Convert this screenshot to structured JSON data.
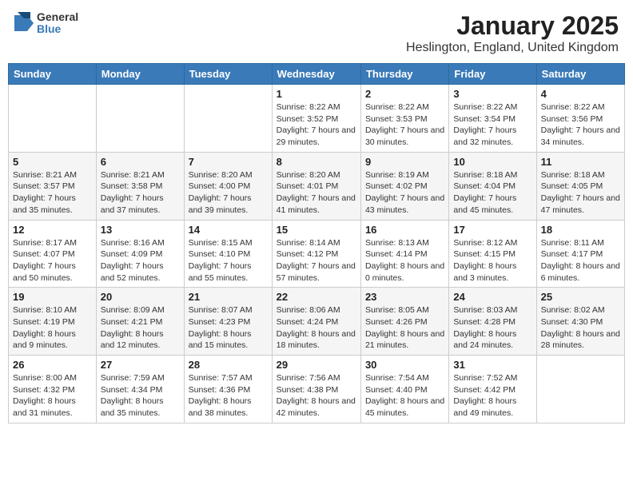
{
  "header": {
    "logo_general": "General",
    "logo_blue": "Blue",
    "month_title": "January 2025",
    "location": "Heslington, England, United Kingdom"
  },
  "weekdays": [
    "Sunday",
    "Monday",
    "Tuesday",
    "Wednesday",
    "Thursday",
    "Friday",
    "Saturday"
  ],
  "weeks": [
    [
      {
        "day": "",
        "info": ""
      },
      {
        "day": "",
        "info": ""
      },
      {
        "day": "",
        "info": ""
      },
      {
        "day": "1",
        "info": "Sunrise: 8:22 AM\nSunset: 3:52 PM\nDaylight: 7 hours\nand 29 minutes."
      },
      {
        "day": "2",
        "info": "Sunrise: 8:22 AM\nSunset: 3:53 PM\nDaylight: 7 hours\nand 30 minutes."
      },
      {
        "day": "3",
        "info": "Sunrise: 8:22 AM\nSunset: 3:54 PM\nDaylight: 7 hours\nand 32 minutes."
      },
      {
        "day": "4",
        "info": "Sunrise: 8:22 AM\nSunset: 3:56 PM\nDaylight: 7 hours\nand 34 minutes."
      }
    ],
    [
      {
        "day": "5",
        "info": "Sunrise: 8:21 AM\nSunset: 3:57 PM\nDaylight: 7 hours\nand 35 minutes."
      },
      {
        "day": "6",
        "info": "Sunrise: 8:21 AM\nSunset: 3:58 PM\nDaylight: 7 hours\nand 37 minutes."
      },
      {
        "day": "7",
        "info": "Sunrise: 8:20 AM\nSunset: 4:00 PM\nDaylight: 7 hours\nand 39 minutes."
      },
      {
        "day": "8",
        "info": "Sunrise: 8:20 AM\nSunset: 4:01 PM\nDaylight: 7 hours\nand 41 minutes."
      },
      {
        "day": "9",
        "info": "Sunrise: 8:19 AM\nSunset: 4:02 PM\nDaylight: 7 hours\nand 43 minutes."
      },
      {
        "day": "10",
        "info": "Sunrise: 8:18 AM\nSunset: 4:04 PM\nDaylight: 7 hours\nand 45 minutes."
      },
      {
        "day": "11",
        "info": "Sunrise: 8:18 AM\nSunset: 4:05 PM\nDaylight: 7 hours\nand 47 minutes."
      }
    ],
    [
      {
        "day": "12",
        "info": "Sunrise: 8:17 AM\nSunset: 4:07 PM\nDaylight: 7 hours\nand 50 minutes."
      },
      {
        "day": "13",
        "info": "Sunrise: 8:16 AM\nSunset: 4:09 PM\nDaylight: 7 hours\nand 52 minutes."
      },
      {
        "day": "14",
        "info": "Sunrise: 8:15 AM\nSunset: 4:10 PM\nDaylight: 7 hours\nand 55 minutes."
      },
      {
        "day": "15",
        "info": "Sunrise: 8:14 AM\nSunset: 4:12 PM\nDaylight: 7 hours\nand 57 minutes."
      },
      {
        "day": "16",
        "info": "Sunrise: 8:13 AM\nSunset: 4:14 PM\nDaylight: 8 hours\nand 0 minutes."
      },
      {
        "day": "17",
        "info": "Sunrise: 8:12 AM\nSunset: 4:15 PM\nDaylight: 8 hours\nand 3 minutes."
      },
      {
        "day": "18",
        "info": "Sunrise: 8:11 AM\nSunset: 4:17 PM\nDaylight: 8 hours\nand 6 minutes."
      }
    ],
    [
      {
        "day": "19",
        "info": "Sunrise: 8:10 AM\nSunset: 4:19 PM\nDaylight: 8 hours\nand 9 minutes."
      },
      {
        "day": "20",
        "info": "Sunrise: 8:09 AM\nSunset: 4:21 PM\nDaylight: 8 hours\nand 12 minutes."
      },
      {
        "day": "21",
        "info": "Sunrise: 8:07 AM\nSunset: 4:23 PM\nDaylight: 8 hours\nand 15 minutes."
      },
      {
        "day": "22",
        "info": "Sunrise: 8:06 AM\nSunset: 4:24 PM\nDaylight: 8 hours\nand 18 minutes."
      },
      {
        "day": "23",
        "info": "Sunrise: 8:05 AM\nSunset: 4:26 PM\nDaylight: 8 hours\nand 21 minutes."
      },
      {
        "day": "24",
        "info": "Sunrise: 8:03 AM\nSunset: 4:28 PM\nDaylight: 8 hours\nand 24 minutes."
      },
      {
        "day": "25",
        "info": "Sunrise: 8:02 AM\nSunset: 4:30 PM\nDaylight: 8 hours\nand 28 minutes."
      }
    ],
    [
      {
        "day": "26",
        "info": "Sunrise: 8:00 AM\nSunset: 4:32 PM\nDaylight: 8 hours\nand 31 minutes."
      },
      {
        "day": "27",
        "info": "Sunrise: 7:59 AM\nSunset: 4:34 PM\nDaylight: 8 hours\nand 35 minutes."
      },
      {
        "day": "28",
        "info": "Sunrise: 7:57 AM\nSunset: 4:36 PM\nDaylight: 8 hours\nand 38 minutes."
      },
      {
        "day": "29",
        "info": "Sunrise: 7:56 AM\nSunset: 4:38 PM\nDaylight: 8 hours\nand 42 minutes."
      },
      {
        "day": "30",
        "info": "Sunrise: 7:54 AM\nSunset: 4:40 PM\nDaylight: 8 hours\nand 45 minutes."
      },
      {
        "day": "31",
        "info": "Sunrise: 7:52 AM\nSunset: 4:42 PM\nDaylight: 8 hours\nand 49 minutes."
      },
      {
        "day": "",
        "info": ""
      }
    ]
  ]
}
